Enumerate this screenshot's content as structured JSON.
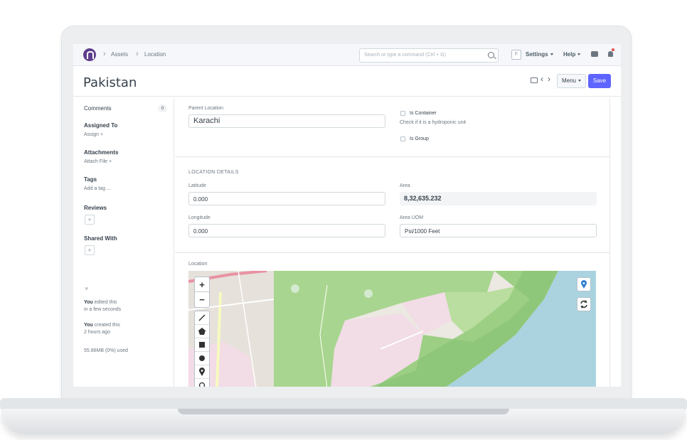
{
  "navbar": {
    "breadcrumbs": [
      "Assets",
      "Location"
    ],
    "search_placeholder": "Search or type a command (Ctrl + G)",
    "f_badge": "F",
    "settings": "Settings",
    "help": "Help"
  },
  "page": {
    "title": "Pakistan",
    "menu_label": "Menu",
    "save_label": "Save"
  },
  "sidebar": {
    "comments_label": "Comments",
    "comments_count": "0",
    "assigned_to_label": "Assigned To",
    "assign_label": "Assign +",
    "attachments_label": "Attachments",
    "attach_file_label": "Attach File +",
    "tags_label": "Tags",
    "add_tag_label": "Add a tag ...",
    "reviews_label": "Reviews",
    "shared_with_label": "Shared With",
    "plus": "+",
    "edited_you": "You",
    "edited_text": " edited this",
    "edited_time": "in a few seconds",
    "created_you": "You",
    "created_text": " created this",
    "created_time": "2 hours ago",
    "storage_used": "55.86MB (0%) used"
  },
  "form": {
    "parent_location_label": "Parent Location",
    "parent_location_value": "Karachi",
    "is_container_label": "Is Container",
    "is_container_help": "Check if it is a hydroponic unit",
    "is_group_label": "Is Group",
    "location_details_title": "LOCATION DETAILS",
    "latitude_label": "Latitude",
    "latitude_value": "0.000",
    "longitude_label": "Longitude",
    "longitude_value": "0.000",
    "area_label": "Area",
    "area_value": "8,32,635.232",
    "area_uom_label": "Area UOM",
    "area_uom_value": "Psi/1000 Feet",
    "location_label": "Location"
  },
  "map": {
    "zoom_in": "+",
    "zoom_out": "−"
  },
  "colors": {
    "primary": "#5e64ff",
    "logo": "#5e3e8c",
    "map_park": "#a8d58f",
    "map_water": "#aad3df"
  }
}
